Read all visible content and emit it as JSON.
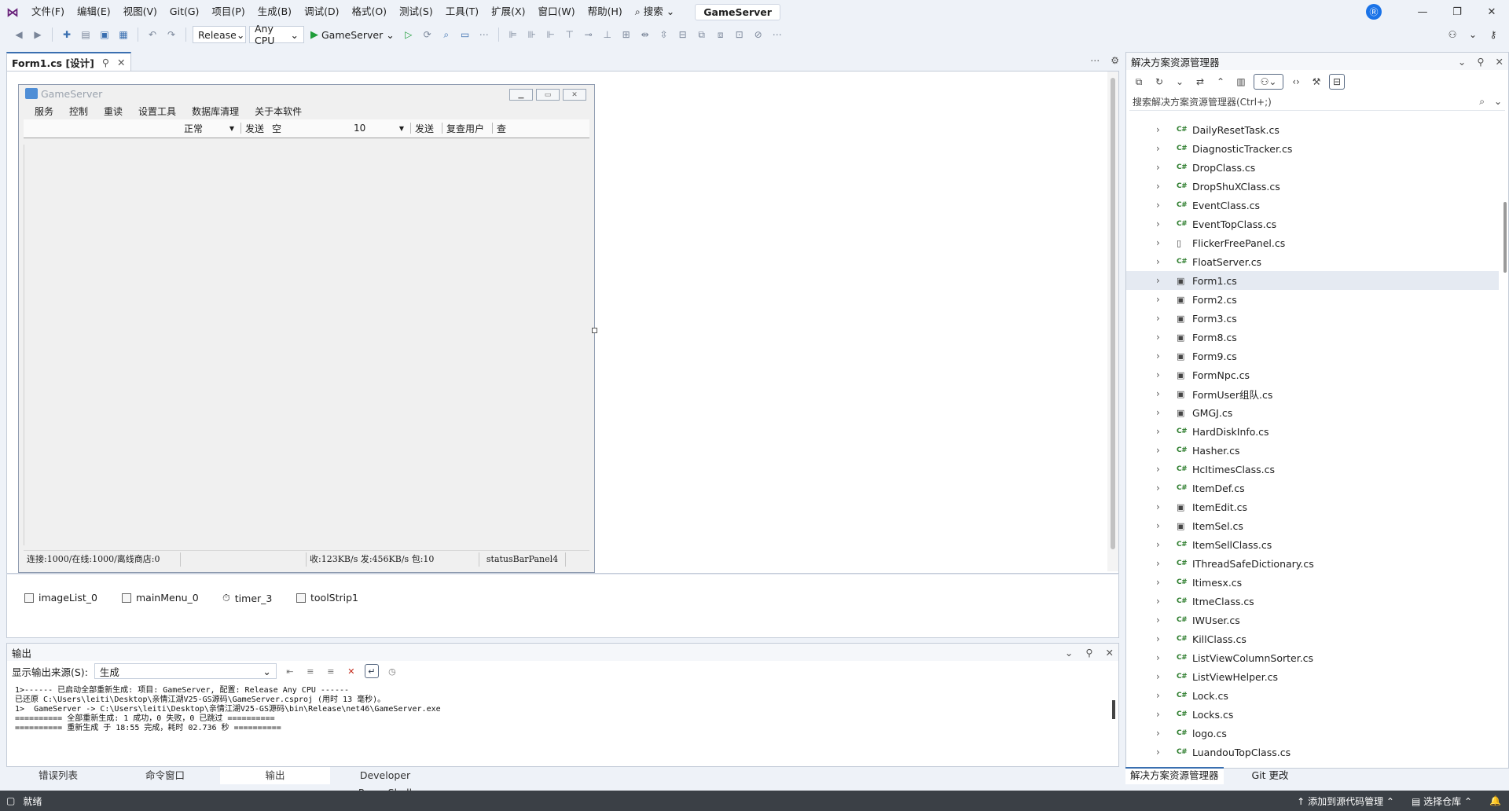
{
  "menu": {
    "items": [
      "文件(F)",
      "编辑(E)",
      "视图(V)",
      "Git(G)",
      "项目(P)",
      "生成(B)",
      "调试(D)",
      "格式(O)",
      "测试(S)",
      "工具(T)",
      "扩展(X)",
      "窗口(W)",
      "帮助(H)"
    ],
    "search_label": "搜索",
    "solution_name": "GameServer",
    "avatar_letter": "Ⓡ"
  },
  "toolbar": {
    "config": "Release",
    "platform": "Any CPU",
    "run_target": "GameServer"
  },
  "document": {
    "tab_label": "Form1.cs [设计]"
  },
  "form": {
    "title": "GameServer",
    "menu": [
      "服务",
      "控制",
      "重读",
      "设置工具",
      "数据库清理",
      "关于本软件"
    ],
    "toolstrip": {
      "combo1": "正常",
      "send1": "发送",
      "text_label": "空",
      "combo2": "10",
      "send2": "发送",
      "recheck": "复查用户",
      "query": "查"
    },
    "status": {
      "panel1": "连接:1000/在线:1000/离线商店:0",
      "panel2": "收:123KB/s 发:456KB/s 包:10",
      "panel3": "statusBarPanel4"
    }
  },
  "components": [
    "imageList_0",
    "mainMenu_0",
    "timer_3",
    "toolStrip1"
  ],
  "output": {
    "title": "输出",
    "source_label": "显示输出来源(S):",
    "source_value": "生成",
    "lines": [
      "1>------ 已启动全部重新生成: 项目: GameServer, 配置: Release Any CPU ------",
      "已还原 C:\\Users\\leiti\\Desktop\\亲情江湖V25-GS源码\\GameServer.csproj (用时 13 毫秒)。",
      "1>  GameServer -> C:\\Users\\leiti\\Desktop\\亲情江湖V25-GS源码\\bin\\Release\\net46\\GameServer.exe",
      "========== 全部重新生成: 1 成功，0 失败，0 已跳过 ==========",
      "========== 重新生成 于 18:55 完成，耗时 02.736 秒 =========="
    ]
  },
  "bottom_tabs": [
    "错误列表",
    "命令窗口",
    "输出",
    "Developer PowerShell"
  ],
  "solution_explorer": {
    "title": "解决方案资源管理器",
    "search_placeholder": "搜索解决方案资源管理器(Ctrl+;)",
    "files": [
      {
        "name": "DailyResetTask.cs",
        "icon": "cs"
      },
      {
        "name": "DiagnosticTracker.cs",
        "icon": "cs"
      },
      {
        "name": "DropClass.cs",
        "icon": "cs"
      },
      {
        "name": "DropShuXClass.cs",
        "icon": "cs"
      },
      {
        "name": "EventClass.cs",
        "icon": "cs"
      },
      {
        "name": "EventTopClass.cs",
        "icon": "cs"
      },
      {
        "name": "FlickerFreePanel.cs",
        "icon": "doc"
      },
      {
        "name": "FloatServer.cs",
        "icon": "cs"
      },
      {
        "name": "Form1.cs",
        "icon": "form",
        "selected": true
      },
      {
        "name": "Form2.cs",
        "icon": "form"
      },
      {
        "name": "Form3.cs",
        "icon": "form"
      },
      {
        "name": "Form8.cs",
        "icon": "form"
      },
      {
        "name": "Form9.cs",
        "icon": "form"
      },
      {
        "name": "FormNpc.cs",
        "icon": "form"
      },
      {
        "name": "FormUser组队.cs",
        "icon": "form"
      },
      {
        "name": "GMGJ.cs",
        "icon": "form"
      },
      {
        "name": "HardDiskInfo.cs",
        "icon": "cs"
      },
      {
        "name": "Hasher.cs",
        "icon": "cs"
      },
      {
        "name": "HcItimesClass.cs",
        "icon": "cs"
      },
      {
        "name": "ItemDef.cs",
        "icon": "cs"
      },
      {
        "name": "ItemEdit.cs",
        "icon": "form"
      },
      {
        "name": "ItemSel.cs",
        "icon": "form"
      },
      {
        "name": "ItemSellClass.cs",
        "icon": "cs"
      },
      {
        "name": "IThreadSafeDictionary.cs",
        "icon": "cs"
      },
      {
        "name": "Itimesx.cs",
        "icon": "cs"
      },
      {
        "name": "ItmeClass.cs",
        "icon": "cs"
      },
      {
        "name": "IWUser.cs",
        "icon": "cs"
      },
      {
        "name": "KillClass.cs",
        "icon": "cs"
      },
      {
        "name": "ListViewColumnSorter.cs",
        "icon": "cs"
      },
      {
        "name": "ListViewHelper.cs",
        "icon": "cs"
      },
      {
        "name": "Lock.cs",
        "icon": "cs"
      },
      {
        "name": "Locks.cs",
        "icon": "cs"
      },
      {
        "name": "logo.cs",
        "icon": "cs"
      },
      {
        "name": "LuandouTopClass.cs",
        "icon": "cs"
      }
    ],
    "tabs": [
      "解决方案资源管理器",
      "Git 更改"
    ]
  },
  "statusbar": {
    "ready": "就绪",
    "add_source": "添加到源代码管理",
    "select_repo": "选择仓库"
  },
  "colors": {
    "accent": "#3a6fb0",
    "chrome_bg": "#eef2f8",
    "statusbar_bg": "#3b4046"
  }
}
